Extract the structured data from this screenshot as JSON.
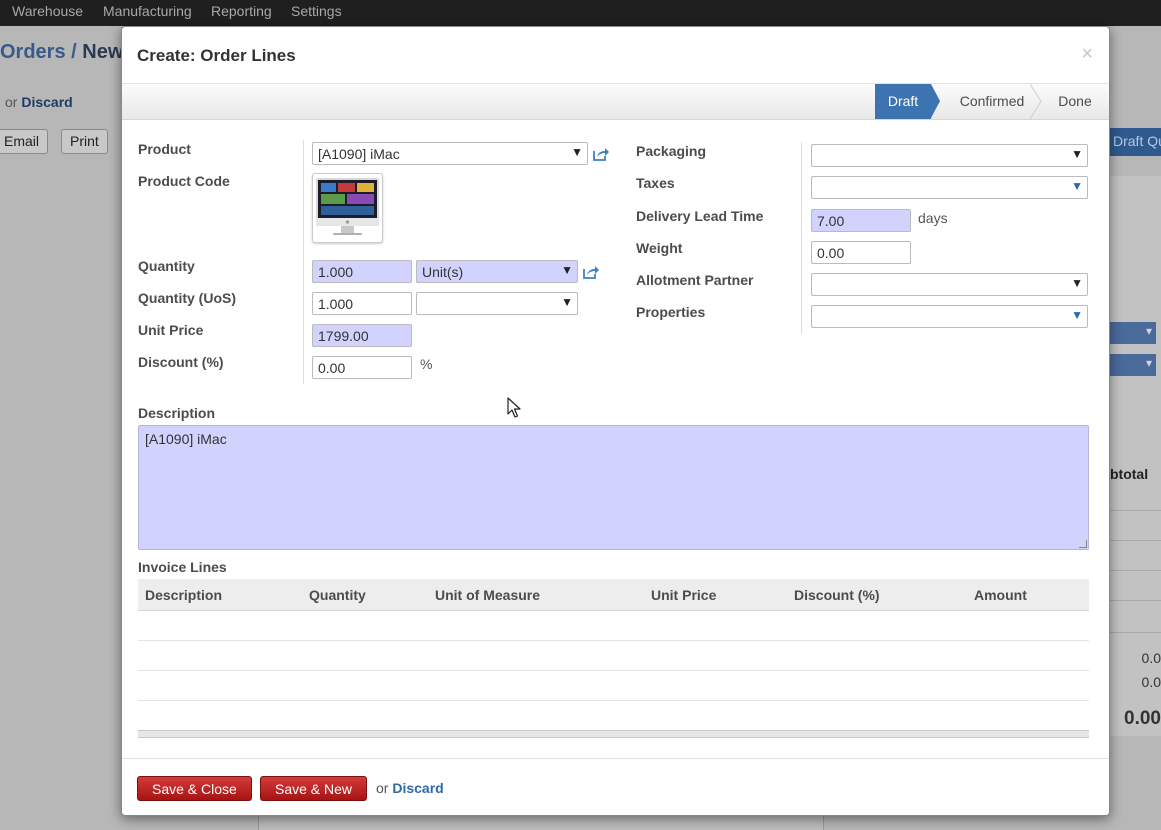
{
  "background": {
    "menu": [
      "Warehouse",
      "Manufacturing",
      "Reporting",
      "Settings"
    ],
    "breadcrumb_parent": "Orders",
    "breadcrumb_sep": "/",
    "breadcrumb_current": "New",
    "or_text": "or",
    "discard": "Discard",
    "email_button": "Email",
    "print_button": "Print",
    "right_button": "Draft Quo",
    "subtotal_header": "btotal",
    "totals": [
      "0.0",
      "0.0",
      "0.00"
    ]
  },
  "modal": {
    "title": "Create: Order Lines",
    "close_symbol": "×",
    "statusbar": {
      "steps": [
        "Draft",
        "Confirmed",
        "Done"
      ],
      "active": "Draft"
    },
    "left_fields": {
      "product_label": "Product",
      "product_value": "[A1090] iMac",
      "product_code_label": "Product Code",
      "quantity_label": "Quantity",
      "quantity_value": "1.000",
      "uom_value": "Unit(s)",
      "quantity_uos_label": "Quantity (UoS)",
      "quantity_uos_value": "1.000",
      "uos_value": "",
      "unit_price_label": "Unit Price",
      "unit_price_value": "1799.00",
      "discount_label": "Discount (%)",
      "discount_value": "0.00",
      "discount_suffix": "%"
    },
    "right_fields": {
      "packaging_label": "Packaging",
      "packaging_value": "",
      "taxes_label": "Taxes",
      "taxes_value": "",
      "delivery_lead_label": "Delivery Lead Time",
      "delivery_lead_value": "7.00",
      "delivery_lead_suffix": "days",
      "weight_label": "Weight",
      "weight_value": "0.00",
      "allotment_label": "Allotment Partner",
      "allotment_value": "",
      "properties_label": "Properties",
      "properties_value": ""
    },
    "description_label": "Description",
    "description_value": "[A1090] iMac",
    "invoice_lines": {
      "label": "Invoice Lines",
      "columns": [
        "Description",
        "Quantity",
        "Unit of Measure",
        "Unit Price",
        "Discount (%)",
        "Amount"
      ],
      "rows": []
    },
    "footer": {
      "save_close": "Save & Close",
      "save_new": "Save & New",
      "or_text": "or",
      "discard": "Discard"
    },
    "colors": {
      "required_field": "#d2d2ff",
      "status_active": "#3d73b0",
      "button_red": "#b41d1d",
      "link": "#2c6ba8"
    },
    "icons": [
      "external-link-icon",
      "product-image-icon",
      "dropdown-arrow-icon",
      "close-icon",
      "mouse-cursor-icon"
    ]
  }
}
